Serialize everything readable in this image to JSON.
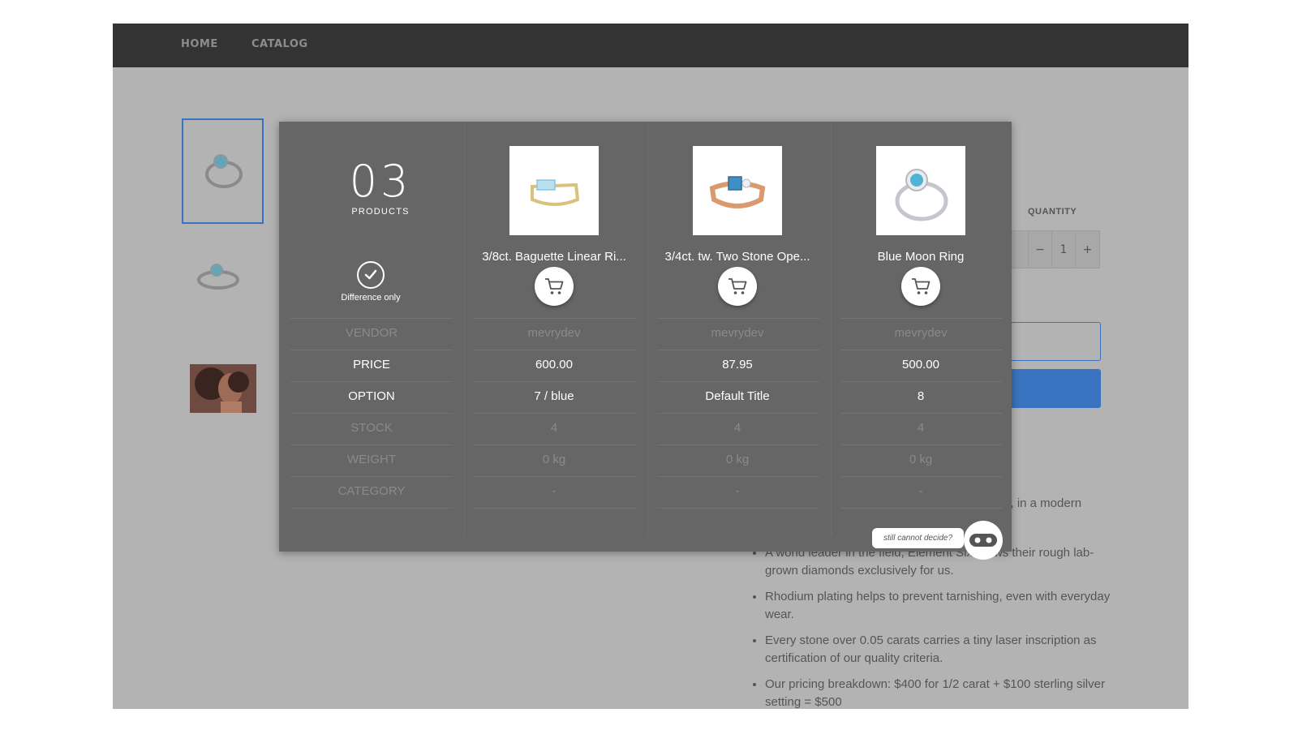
{
  "nav": {
    "home": "HOME",
    "catalog": "CATALOG"
  },
  "product_page": {
    "quantity_label": "QUANTITY",
    "quantity_minus": "−",
    "quantity_value": "1",
    "quantity_plus": "+",
    "description_partial": "s, in a modern",
    "bullets": [
      "A world leader in the field, Element Six grows their rough lab-grown diamonds exclusively for us.",
      "Rhodium plating helps to prevent tarnishing, even with everyday wear.",
      "Every stone over 0.05 carats carries a tiny laser inscription as certification of our quality criteria.",
      "Our pricing breakdown: $400 for 1/2 carat + $100 sterling silver setting = $500"
    ]
  },
  "compare": {
    "count": "03",
    "count_label": "PRODUCTS",
    "difference_only_label": "Difference only",
    "rows": [
      {
        "label": "VENDOR",
        "values": [
          "mevrydev",
          "mevrydev",
          "mevrydev"
        ],
        "highlight": false
      },
      {
        "label": "PRICE",
        "values": [
          "600.00",
          "87.95",
          "500.00"
        ],
        "highlight": true
      },
      {
        "label": "OPTION",
        "values": [
          "7 / blue",
          "Default Title",
          "8"
        ],
        "highlight": true
      },
      {
        "label": "STOCK",
        "values": [
          "4",
          "4",
          "4"
        ],
        "highlight": false
      },
      {
        "label": "WEIGHT",
        "values": [
          "0 kg",
          "0 kg",
          "0 kg"
        ],
        "highlight": false
      },
      {
        "label": "CATEGORY",
        "values": [
          "-",
          "-",
          "-"
        ],
        "highlight": false
      }
    ],
    "products": [
      {
        "name": "3/8ct. Baguette Linear Ri...",
        "metal": "#d9c27a",
        "stone": "#8cc6e0"
      },
      {
        "name": "3/4ct. tw. Two Stone Ope...",
        "metal": "#d99a70",
        "stone": "#3f8fc4"
      },
      {
        "name": "Blue Moon Ring",
        "metal": "#c4c8cc",
        "stone": "#4fb3d6"
      }
    ],
    "help_text": "still cannot decide?"
  },
  "colors": {
    "accent": "#3a73c0",
    "nav_bg": "#333333",
    "modal_bg": "#666666",
    "overlay_bg": "#b3b3b3"
  }
}
